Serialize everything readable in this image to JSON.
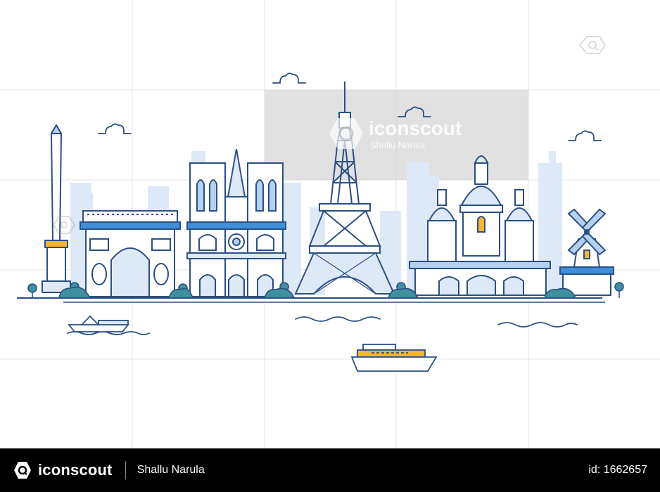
{
  "watermark": {
    "brand": "iconscout",
    "author": "Shallu Narula"
  },
  "footer": {
    "brand": "iconscout",
    "author": "Shallu Narula",
    "id_label": "id: 1662657"
  },
  "colors": {
    "stroke": "#2a4f86",
    "light_blue": "#dde9f7",
    "mid_blue": "#b5d1f0",
    "accent_blue": "#3e8fd8",
    "gold": "#f3b533",
    "tree_green": "#3f8f9e",
    "grid_line": "#e6e6e6",
    "watermark_box": "#c8c8c8"
  },
  "icons": [
    "search-icon",
    "iconscout-logo-icon",
    "cloud-icon",
    "tree-icon"
  ]
}
